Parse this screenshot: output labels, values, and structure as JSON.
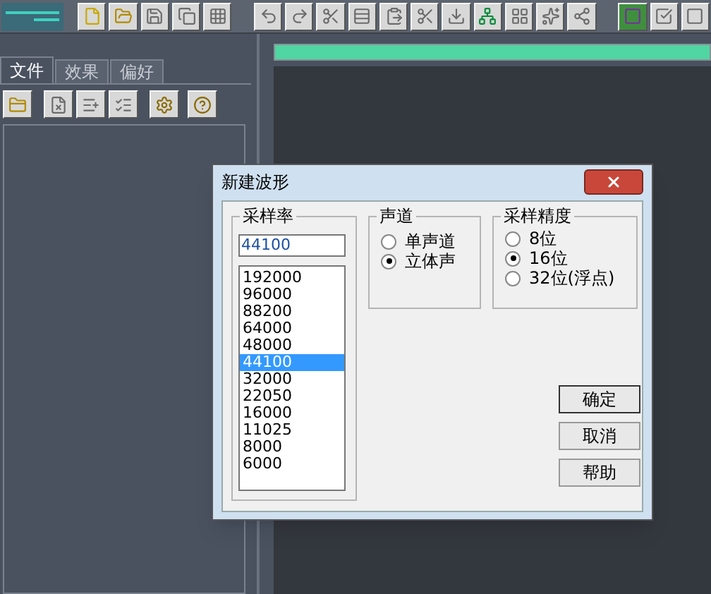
{
  "panel_tabs": [
    {
      "label": "文件",
      "selected": true
    },
    {
      "label": "效果",
      "selected": false
    },
    {
      "label": "偏好",
      "selected": false
    }
  ],
  "track": {
    "level": 1
  },
  "dialog": {
    "title": "新建波形",
    "sample_rate": {
      "title": "采样率",
      "value": "44100",
      "options": [
        {
          "label": "192000",
          "selected": false
        },
        {
          "label": "96000",
          "selected": false
        },
        {
          "label": "88200",
          "selected": false
        },
        {
          "label": "64000",
          "selected": false
        },
        {
          "label": "48000",
          "selected": false
        },
        {
          "label": "44100",
          "selected": true
        },
        {
          "label": "32000",
          "selected": false
        },
        {
          "label": "22050",
          "selected": false
        },
        {
          "label": "16000",
          "selected": false
        },
        {
          "label": "11025",
          "selected": false
        },
        {
          "label": "8000",
          "selected": false
        },
        {
          "label": "6000",
          "selected": false
        }
      ]
    },
    "channels": {
      "title": "声道",
      "options": [
        {
          "label": "单声道",
          "selected": false
        },
        {
          "label": "立体声",
          "selected": true
        }
      ]
    },
    "resolution": {
      "title": "采样精度",
      "options": [
        {
          "label": "8位",
          "selected": false
        },
        {
          "label": "16位",
          "selected": true
        },
        {
          "label": "32位(浮点)",
          "selected": false
        }
      ]
    },
    "buttons": [
      "确定",
      "取消",
      "帮助"
    ]
  }
}
